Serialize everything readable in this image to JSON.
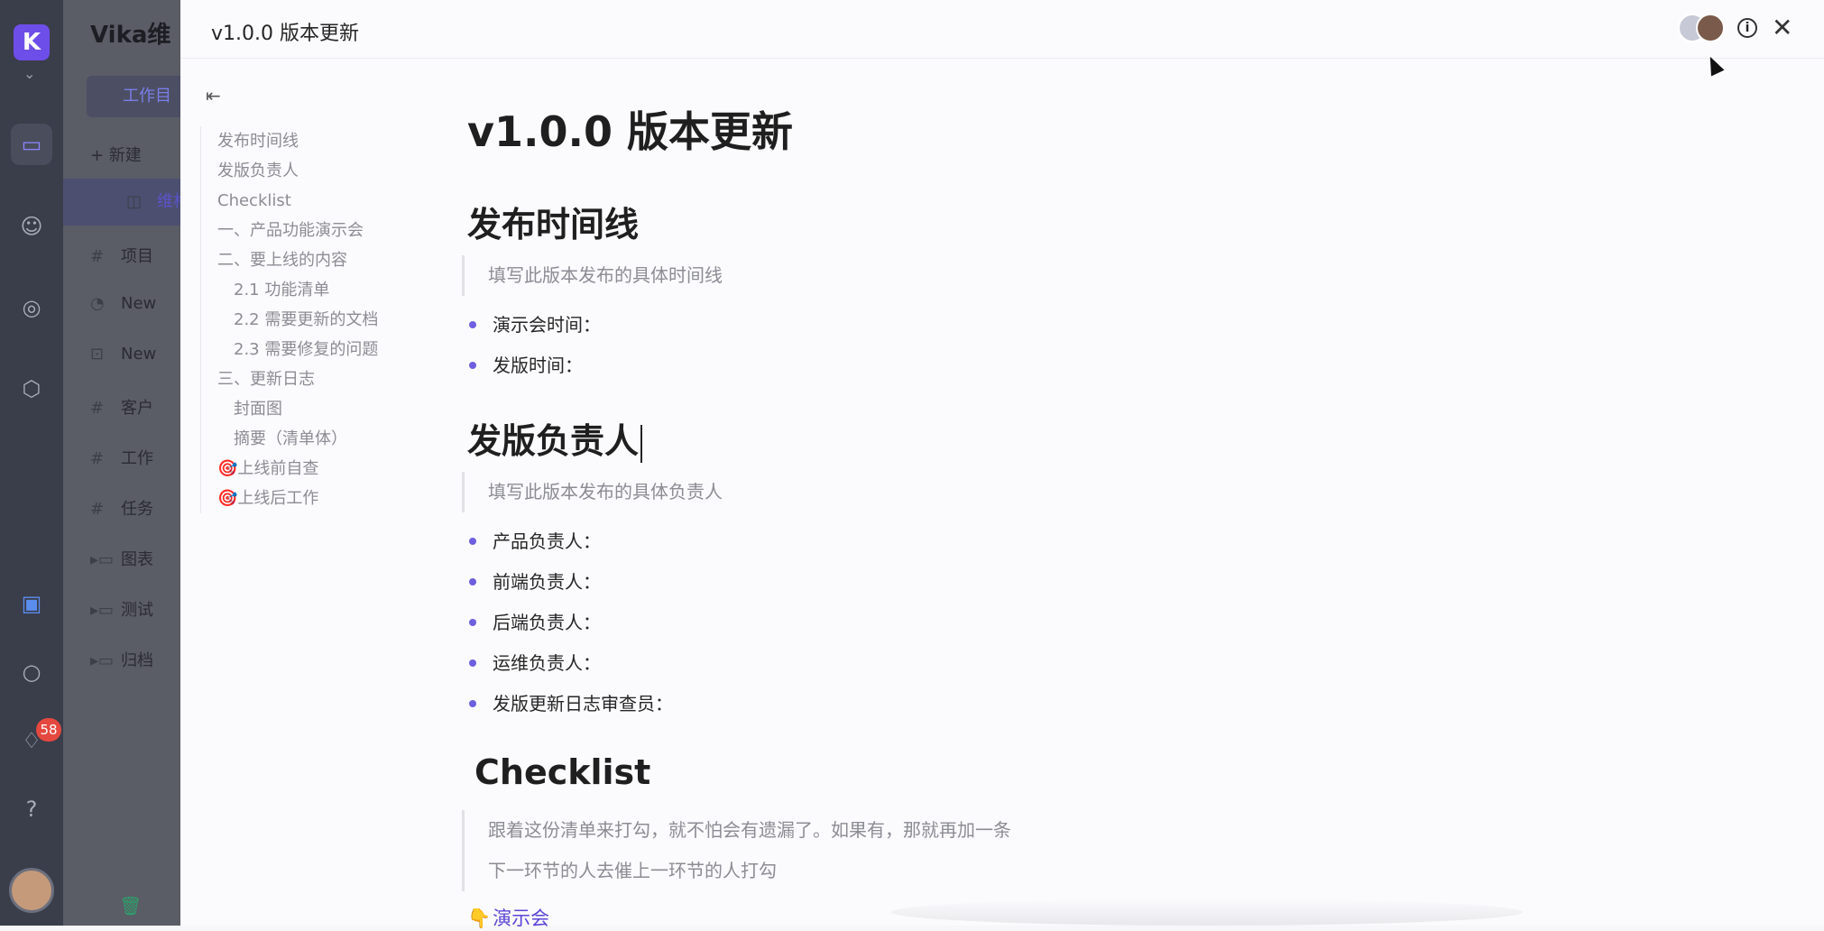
{
  "app": {
    "workspace_title": "Vika维",
    "workspace_tab": "工作目",
    "new_label": "+ 新建",
    "notification_count": "58",
    "sidebar_items": [
      {
        "icon": "board-icon",
        "label": "维格"
      },
      {
        "icon": "hash-icon",
        "label": "项目"
      },
      {
        "icon": "gauge-icon",
        "label": "New"
      },
      {
        "icon": "robot-icon",
        "label": "New"
      },
      {
        "icon": "hash-icon",
        "label": "客户"
      },
      {
        "icon": "hash-icon",
        "label": "工作"
      },
      {
        "icon": "hash-icon",
        "label": "任务"
      },
      {
        "icon": "folder-icon",
        "label": "图表"
      },
      {
        "icon": "folder-icon",
        "label": "测试"
      },
      {
        "icon": "folder-icon",
        "label": "归档"
      }
    ]
  },
  "panel": {
    "title": "v1.0.0 版本更新"
  },
  "toc": {
    "items": [
      {
        "label": "发布时间线",
        "level": 1
      },
      {
        "label": "发版负责人",
        "level": 1
      },
      {
        "label": "Checklist",
        "level": 1
      },
      {
        "label": "一、产品功能演示会",
        "level": 1
      },
      {
        "label": "二、要上线的内容",
        "level": 1
      },
      {
        "label": "2.1 功能清单",
        "level": 2
      },
      {
        "label": "2.2 需要更新的文档",
        "level": 2
      },
      {
        "label": "2.3 需要修复的问题",
        "level": 2
      },
      {
        "label": "三、更新日志",
        "level": 1
      },
      {
        "label": "封面图",
        "level": 2
      },
      {
        "label": "摘要（清单体）",
        "level": 2
      },
      {
        "label": "🎯上线前自查",
        "level": 1
      },
      {
        "label": "🎯上线后工作",
        "level": 1
      }
    ]
  },
  "doc": {
    "title": "v1.0.0 版本更新",
    "section1": {
      "heading": "发布时间线",
      "quote": "填写此版本发布的具体时间线",
      "bullets": [
        "演示会时间：",
        "发版时间："
      ]
    },
    "section2": {
      "heading": "发版负责人",
      "quote": "填写此版本发布的具体负责人",
      "bullets": [
        "产品负责人：",
        "前端负责人：",
        "后端负责人：",
        "运维负责人：",
        "发版更新日志审查员："
      ]
    },
    "section3": {
      "heading": "Checklist",
      "quote_lines": [
        "跟着这份清单来打勾，就不怕会有遗漏了。如果有，那就再加一条",
        "下一环节的人去催上一环节的人打勾"
      ],
      "link": "演示会"
    }
  },
  "colors": {
    "accent": "#6e5fe0",
    "link": "#5b45d6",
    "rail": "#3a3d4a",
    "badge": "#e5483f"
  }
}
